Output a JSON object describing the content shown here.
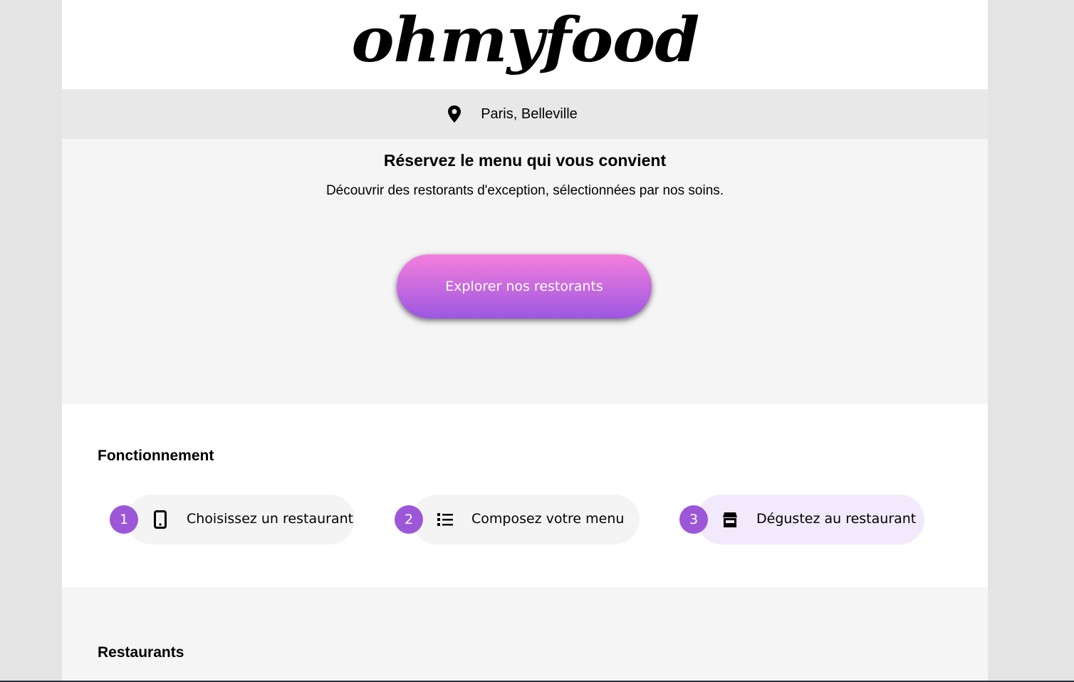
{
  "brand": {
    "logo_text": "ohmyfood"
  },
  "location": {
    "icon": "map-pin-icon",
    "label": "Paris, Belleville"
  },
  "hero": {
    "title": "Réservez le menu qui vous convient",
    "subtitle": "Découvrir des restorants d'exception, sélectionnées par nos soins.",
    "cta_label": "Explorer nos restorants"
  },
  "how_it_works": {
    "title": "Fonctionnement",
    "steps": [
      {
        "number": "1",
        "icon": "smartphone-icon",
        "label": "Choisissez un restaurant"
      },
      {
        "number": "2",
        "icon": "list-icon",
        "label": "Composez votre menu"
      },
      {
        "number": "3",
        "icon": "store-icon",
        "label": "Dégustez au restaurant"
      }
    ]
  },
  "restaurants": {
    "title": "Restaurants"
  },
  "colors": {
    "accent": "#9c57d9",
    "gradient_start": "#f47fdd",
    "gradient_end": "#9c57e0",
    "active_step_bg": "#f2e9fc"
  }
}
